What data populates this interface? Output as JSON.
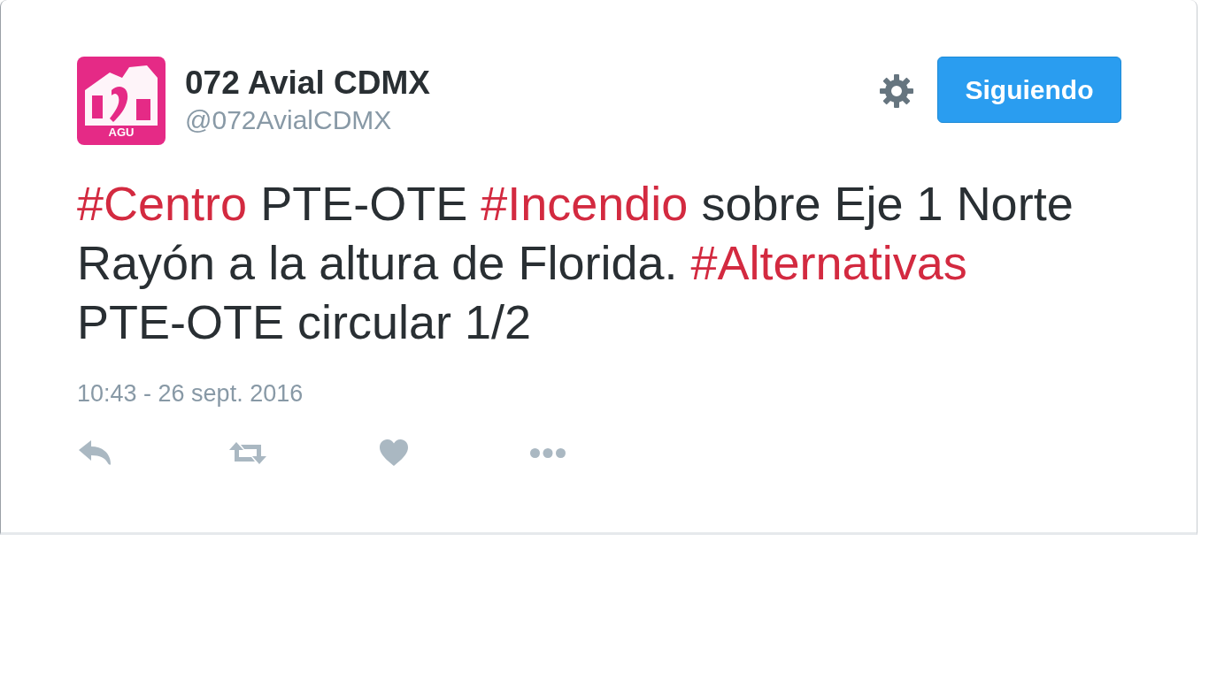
{
  "profile": {
    "avatar": {
      "logo_text": "AGU"
    },
    "name": "072 Avial CDMX",
    "handle": "@072AvialCDMX"
  },
  "follow_button": {
    "label": "Siguiendo"
  },
  "tweet": {
    "segments": [
      {
        "kind": "hashtag",
        "text": "#Centro"
      },
      {
        "kind": "plain",
        "text": " PTE-OTE "
      },
      {
        "kind": "hashtag",
        "text": "#Incendio"
      },
      {
        "kind": "plain",
        "text": " sobre Eje 1 Norte Rayón a la altura de Florida. "
      },
      {
        "kind": "hashtag",
        "text": "#Alternativas"
      },
      {
        "kind": "plain",
        "text": " PTE-OTE circular 1/2"
      }
    ],
    "timestamp": "10:43 - 26 sept. 2016"
  },
  "actions": [
    {
      "kind": "reply"
    },
    {
      "kind": "retweet"
    },
    {
      "kind": "like"
    },
    {
      "kind": "more"
    }
  ]
}
